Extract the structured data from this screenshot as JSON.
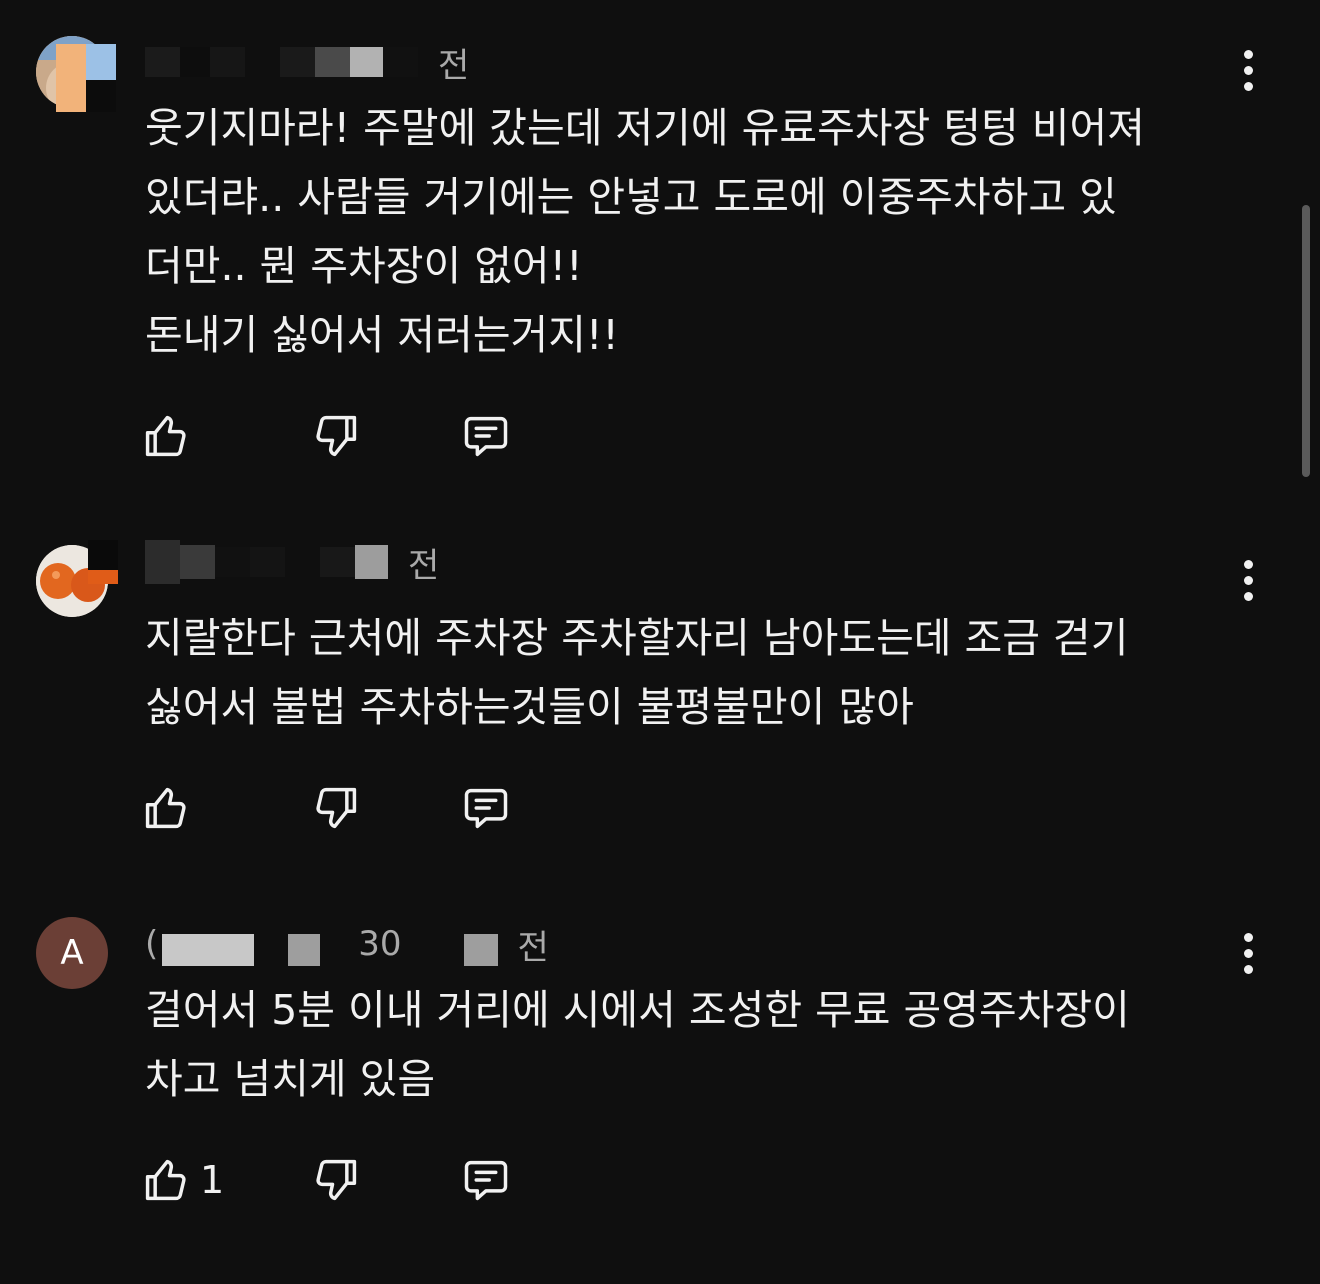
{
  "comments": [
    {
      "meta_suffix": "전",
      "text": "웃기지마라! 주말에 갔는데 저기에 유료주차장 텅텅 비어져\n있더랴.. 사람들 거기에는 안넣고 도로에 이중주차하고 있\n더만.. 뭔 주차장이 없어!!\n돈내기 싫어서 저러는거지!!",
      "like_count": "",
      "icons": [
        "thumb-up-icon",
        "thumb-down-icon",
        "reply-icon",
        "more-vert-icon"
      ]
    },
    {
      "meta_suffix": "전",
      "text": "지랄한다 근처에 주차장 주차할자리 남아도는데 조금 걷기\n싫어서 불법 주차하는것들이 불평불만이 많아",
      "like_count": "",
      "icons": [
        "thumb-up-icon",
        "thumb-down-icon",
        "reply-icon",
        "more-vert-icon"
      ]
    },
    {
      "avatar_letter": "A",
      "meta_partial": "(",
      "meta_partial2": "30",
      "meta_suffix": "전",
      "text": "걸어서 5분 이내 거리에 시에서 조성한 무료 공영주차장이\n차고 넘치게 있음",
      "like_count": "1",
      "icons": [
        "thumb-up-icon",
        "thumb-down-icon",
        "reply-icon",
        "more-vert-icon"
      ]
    }
  ],
  "colors": {
    "background": "#0f0f0f",
    "text": "#f1f1f1",
    "meta": "#aaaaaa",
    "avatar_letter_bg": "#6b3f36"
  }
}
